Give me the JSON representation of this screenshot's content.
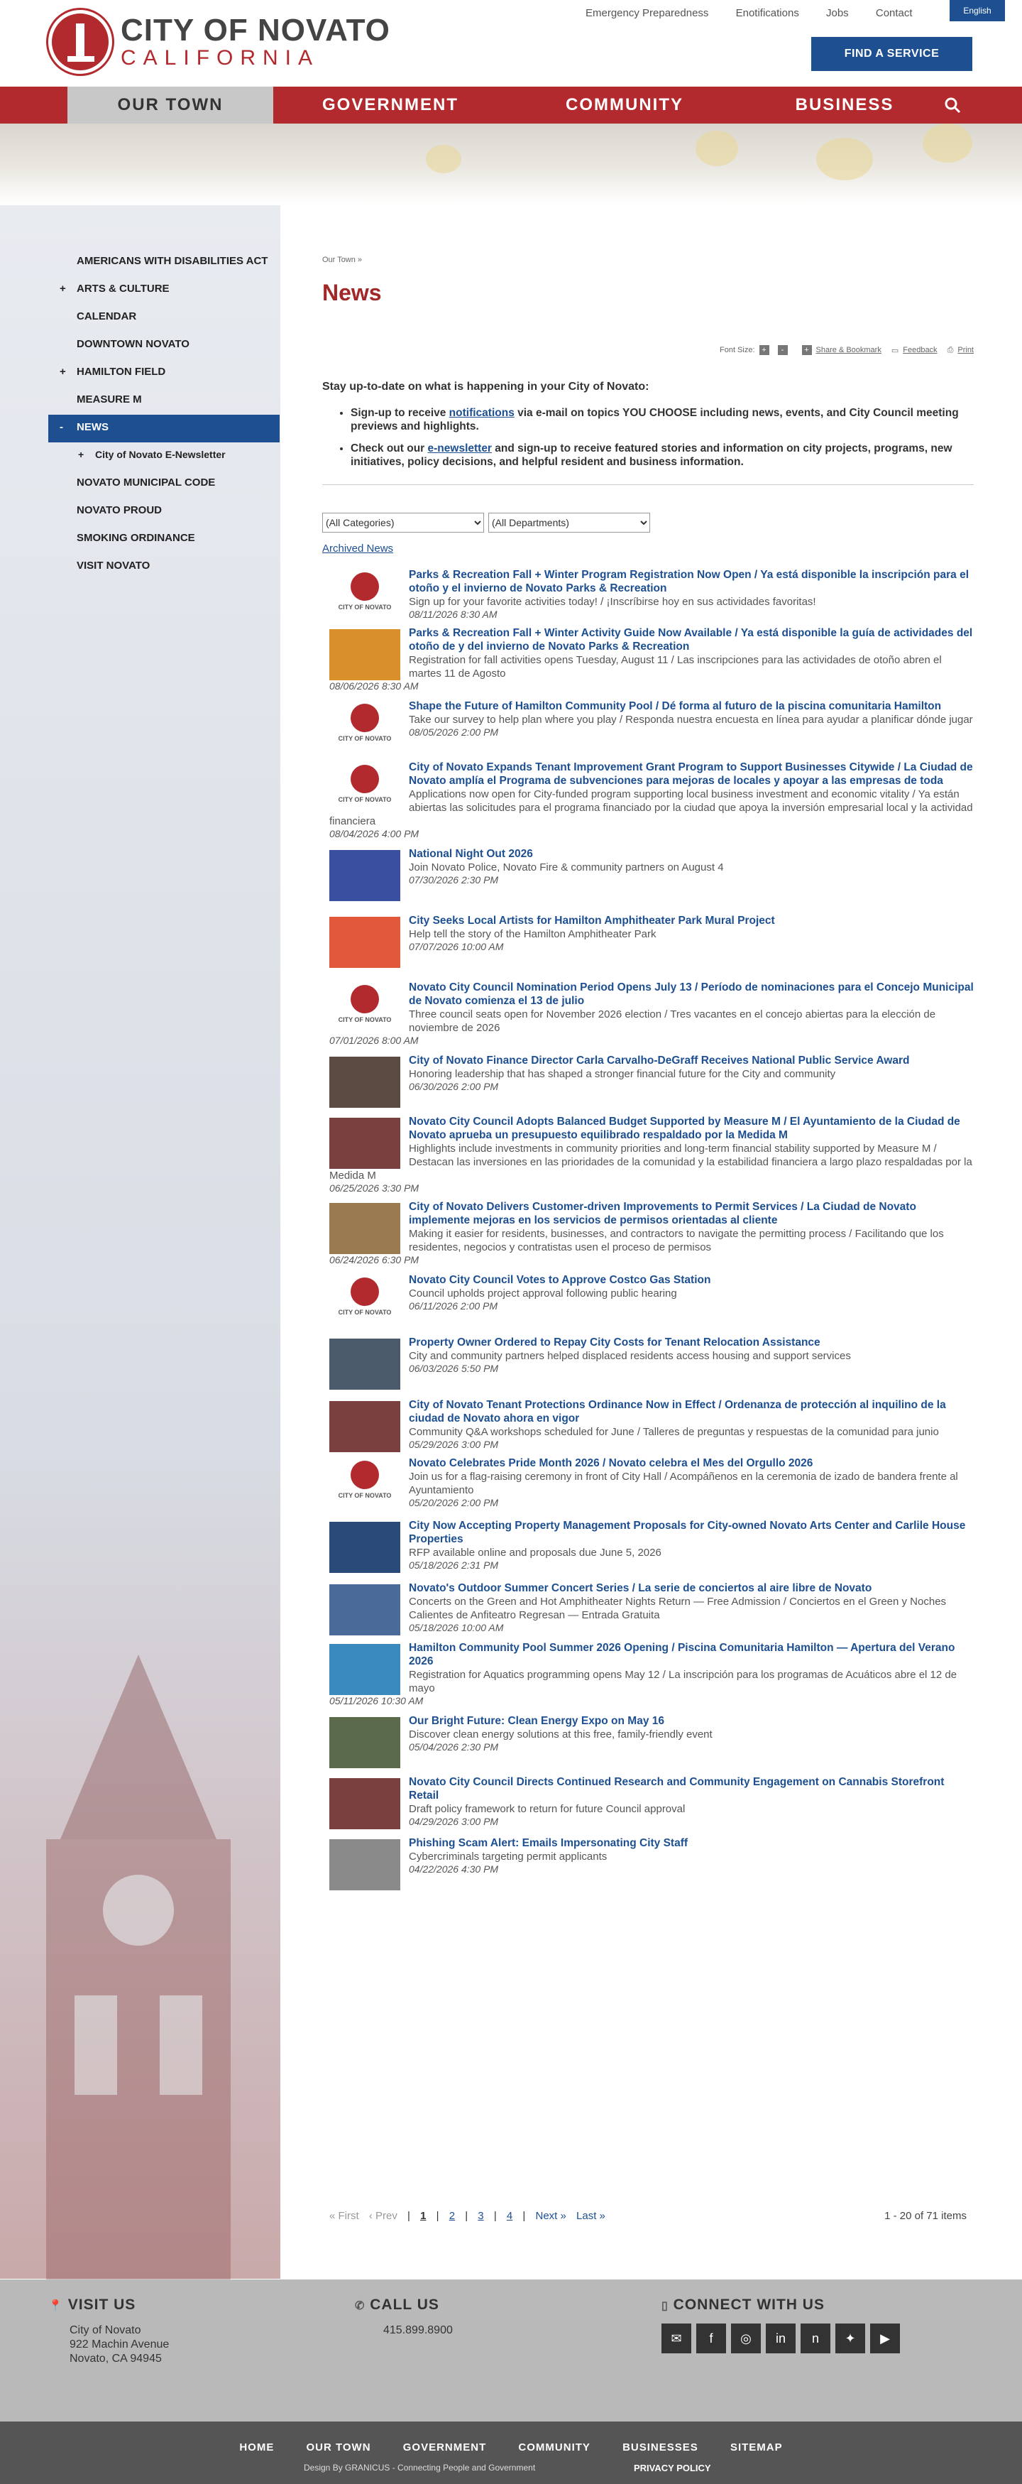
{
  "header": {
    "city": "CITY OF NOVATO",
    "state": "CALIFORNIA",
    "utility": [
      "Emergency Preparedness",
      "Enotifications",
      "Jobs",
      "Contact"
    ],
    "lang": "English",
    "find": "FIND A SERVICE"
  },
  "nav": [
    "OUR TOWN",
    "GOVERNMENT",
    "COMMUNITY",
    "BUSINESS"
  ],
  "sidenav": [
    {
      "pm": "",
      "label": "AMERICANS WITH DISABILITIES ACT"
    },
    {
      "pm": "+",
      "label": "ARTS & CULTURE"
    },
    {
      "pm": "",
      "label": "CALENDAR"
    },
    {
      "pm": "",
      "label": "DOWNTOWN NOVATO"
    },
    {
      "pm": "+",
      "label": "HAMILTON FIELD"
    },
    {
      "pm": "",
      "label": "MEASURE M"
    },
    {
      "pm": "-",
      "label": "NEWS"
    },
    {
      "pm": "+",
      "label": "City of Novato E-Newsletter"
    },
    {
      "pm": "",
      "label": "NOVATO MUNICIPAL CODE"
    },
    {
      "pm": "",
      "label": "NOVATO PROUD"
    },
    {
      "pm": "",
      "label": "SMOKING ORDINANCE"
    },
    {
      "pm": "",
      "label": "VISIT NOVATO"
    }
  ],
  "breadcrumb": "Our Town »",
  "title": "News",
  "tools": {
    "fontsize": "Font Size:",
    "plus": "+",
    "minus": "-",
    "share": "Share & Bookmark",
    "feedback": "Feedback",
    "print": "Print"
  },
  "intro": {
    "lead": "Stay up-to-date on what is happening in your City of Novato:",
    "b1a": "Sign-up to receive ",
    "b1link": "notifications",
    "b1b": " via e-mail on topics YOU CHOOSE including news, events, and City Council meeting previews and highlights.",
    "b2a": "Check out our ",
    "b2link": "e-newsletter",
    "b2b": " and sign-up to receive featured stories and information on city projects, programs, new initiatives, policy decisions, and helpful resident and business information."
  },
  "filters": {
    "categories": "(All Categories)",
    "departments": "(All Departments)"
  },
  "archived": "Archived News",
  "news": [
    {
      "thumb": "logo",
      "title": "Parks & Recreation Fall + Winter Program Registration Now Open / Ya está disponible la inscripción para el otoño y el invierno de Novato Parks & Recreation",
      "desc": "Sign up for your favorite activities today! / ¡Inscríbirse hoy en sus actividades favoritas!",
      "date": "08/11/2026 8:30 AM"
    },
    {
      "thumb": "#d9902b",
      "title": "Parks & Recreation Fall + Winter Activity Guide Now Available / Ya está disponible la guía de actividades del otoño de y del invierno de Novato Parks & Recreation",
      "desc": "Registration for fall activities opens Tuesday, August 11 / Las inscripciones para las actividades de otoño abren el martes 11 de Agosto",
      "date": "08/06/2026 8:30 AM"
    },
    {
      "thumb": "logo",
      "title": "Shape the Future of Hamilton Community Pool / Dé forma al futuro de la piscina comunitaria Hamilton",
      "desc": "Take our survey to help plan where you play / Responda nuestra encuesta en línea para ayudar a planificar dónde jugar",
      "date": "08/05/2026 2:00 PM"
    },
    {
      "thumb": "logo",
      "title": "City of Novato Expands Tenant Improvement Grant Program to Support Businesses Citywide / La Ciudad de Novato amplía el Programa de subvenciones para mejoras de locales y apoyar a las empresas de toda",
      "desc": "Applications now open for City-funded program supporting local business investment and economic vitality / Ya están abiertas las solicitudes para el programa financiado por la ciudad que apoya la inversión empresarial local y la actividad financiera",
      "date": "08/04/2026 4:00 PM"
    },
    {
      "thumb": "#3a4fa0",
      "title": "National Night Out 2026",
      "desc": "Join Novato Police, Novato Fire & community partners on August 4",
      "date": "07/30/2026 2:30 PM"
    },
    {
      "thumb": "#e2583a",
      "title": "City Seeks Local Artists for Hamilton Amphitheater Park Mural Project",
      "desc": "Help tell the story of the Hamilton Amphitheater Park",
      "date": "07/07/2026 10:00 AM"
    },
    {
      "thumb": "logo",
      "title": "Novato City Council Nomination Period Opens July 13 / Período de nominaciones para el Concejo Municipal de Novato comienza el 13 de julio",
      "desc": "Three council seats open for November 2026 election / Tres vacantes en el concejo abiertas para la elección de noviembre de 2026",
      "date": "07/01/2026 8:00 AM"
    },
    {
      "thumb": "#5a4a40",
      "title": "City of Novato Finance Director Carla Carvalho-DeGraff Receives National Public Service Award",
      "desc": "Honoring leadership that has shaped a stronger financial future for the City and community",
      "date": "06/30/2026 2:00 PM"
    },
    {
      "thumb": "#7a4040",
      "title": "Novato City Council Adopts Balanced Budget Supported by Measure M / El Ayuntamiento de la Ciudad de Novato aprueba un presupuesto equilibrado respaldado por la Medida M",
      "desc": "Highlights include investments in community priorities and long-term financial stability supported by Measure M / Destacan las inversiones en las prioridades de la comunidad y la estabilidad financiera a largo plazo respaldadas por la Medida M",
      "date": "06/25/2026 3:30 PM"
    },
    {
      "thumb": "#9a7a50",
      "title": "City of Novato Delivers Customer-driven Improvements to Permit Services / La Ciudad de Novato implemente mejoras en los servicios de permisos orientadas al cliente",
      "desc": "Making it easier for residents, businesses, and contractors to navigate the permitting process / Facilitando que los residentes, negocios y contratistas usen el proceso de permisos",
      "date": "06/24/2026 6:30 PM"
    },
    {
      "thumb": "logo",
      "title": "Novato City Council Votes to Approve Costco Gas Station",
      "desc": "Council upholds project approval following public hearing",
      "date": "06/11/2026 2:00 PM"
    },
    {
      "thumb": "#4a5a6a",
      "title": "Property Owner Ordered to Repay City Costs for Tenant Relocation Assistance",
      "desc": "City and community partners helped displaced residents access housing and support services",
      "date": "06/03/2026 5:50 PM"
    },
    {
      "thumb": "#7a4040",
      "title": "City of Novato Tenant Protections Ordinance Now in Effect / Ordenanza de protección al inquilino de la ciudad de Novato ahora en vigor",
      "desc": "Community Q&A workshops scheduled for June / Talleres de preguntas y respuestas de la comunidad para junio",
      "date": "05/29/2026 3:00 PM"
    },
    {
      "thumb": "logo",
      "title": "Novato Celebrates Pride Month 2026 / Novato celebra el Mes del Orgullo 2026",
      "desc": "Join us for a flag-raising ceremony in front of City Hall / Acompáñenos en la ceremonia de izado de bandera frente al Ayuntamiento",
      "date": "05/20/2026 2:00 PM"
    },
    {
      "thumb": "#2a4a7a",
      "title": "City Now Accepting Property Management Proposals for City-owned Novato Arts Center and Carlile House Properties",
      "desc": "RFP available online and proposals due June 5, 2026",
      "date": "05/18/2026 2:31 PM"
    },
    {
      "thumb": "#4a6a9a",
      "title": "Novato's Outdoor Summer Concert Series / La serie de conciertos al aire libre de Novato",
      "desc": "Concerts on the Green and Hot Amphitheater Nights Return — Free Admission / Conciertos en el Green y Noches Calientes de Anfiteatro Regresan — Entrada Gratuita",
      "date": "05/18/2026 10:00 AM"
    },
    {
      "thumb": "#3a8ac0",
      "title": "Hamilton Community Pool Summer 2026 Opening / Piscina Comunitaria Hamilton — Apertura del Verano 2026",
      "desc": "Registration for Aquatics programming opens May 12 / La inscripción para los programas de Acuáticos abre el 12 de mayo",
      "date": "05/11/2026 10:30 AM"
    },
    {
      "thumb": "#5a6a4a",
      "title": "Our Bright Future: Clean Energy Expo on May 16",
      "desc": "Discover clean energy solutions at this free, family-friendly event",
      "date": "05/04/2026 2:30 PM"
    },
    {
      "thumb": "#7a4040",
      "title": "Novato City Council Directs Continued Research and Community Engagement on Cannabis Storefront Retail",
      "desc": "Draft policy framework to return for future Council approval",
      "date": "04/29/2026 3:00 PM"
    },
    {
      "thumb": "#8a8a8a",
      "title": "Phishing Scam Alert: Emails Impersonating City Staff",
      "desc": "Cybercriminals targeting permit applicants",
      "date": "04/22/2026 4:30 PM"
    }
  ],
  "pager": {
    "first": "« First",
    "prev": "‹ Prev",
    "pages": [
      "1",
      "2",
      "3",
      "4"
    ],
    "next": "Next »",
    "last": "Last »",
    "count": "1 - 20 of 71 items"
  },
  "footer": {
    "visit": "VISIT US",
    "addr1": "City of Novato",
    "addr2": "922 Machin Avenue",
    "addr3": "Novato, CA 94945",
    "call": "CALL US",
    "phone": "415.899.8900",
    "connect": "CONNECT WITH US"
  },
  "bottom": {
    "links": [
      "HOME",
      "OUR TOWN",
      "GOVERNMENT",
      "COMMUNITY",
      "BUSINESSES",
      "SITEMAP"
    ],
    "credit": "Design By GRANICUS - Connecting People and Government",
    "privacy": "PRIVACY POLICY"
  }
}
